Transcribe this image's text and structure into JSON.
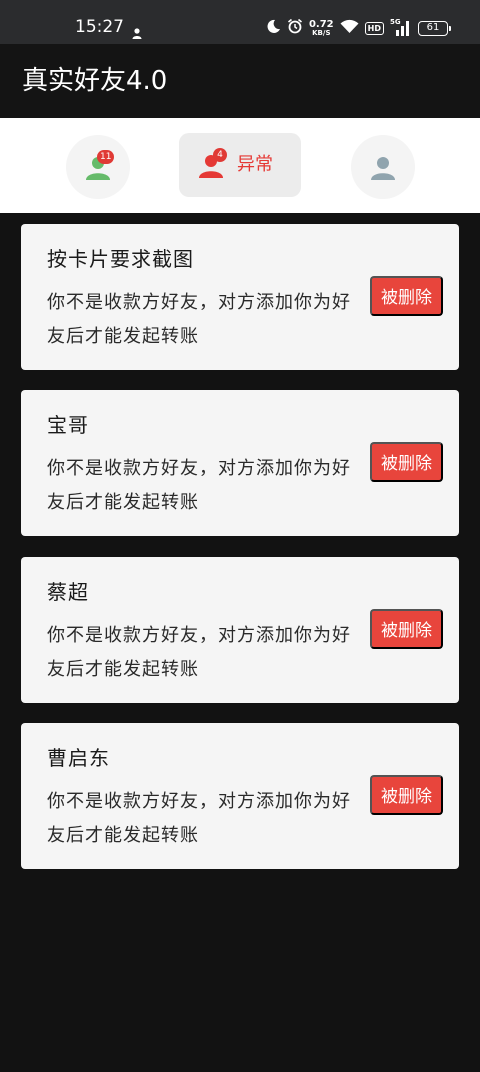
{
  "status_bar": {
    "time": "15:27",
    "net_speed": "0.72",
    "net_unit": "KB/S",
    "hd": "HD",
    "signal": "5G",
    "battery": "61",
    "icons": [
      "person-icon",
      "moon-icon",
      "alarm-icon",
      "wifi-icon",
      "hd-icon",
      "signal-icon",
      "battery-icon"
    ]
  },
  "app": {
    "title": "真实好友4.0"
  },
  "tabs": [
    {
      "name": "normal",
      "badge": "11",
      "icon": "person-icon",
      "color": "#66bb6a"
    },
    {
      "name": "abnormal",
      "badge": "4",
      "label": "异常",
      "icon": "person-icon",
      "color": "#e53935"
    },
    {
      "name": "deleted",
      "icon": "person-icon",
      "color": "#90a4ae"
    }
  ],
  "contacts": [
    {
      "name": "按卡片要求截图",
      "desc": "你不是收款方好友，对方添加你为好友后才能发起转账",
      "button": "被删除"
    },
    {
      "name": "宝哥",
      "desc": "你不是收款方好友，对方添加你为好友后才能发起转账",
      "button": "被删除"
    },
    {
      "name": "蔡超",
      "desc": "你不是收款方好友，对方添加你为好友后才能发起转账",
      "button": "被删除"
    },
    {
      "name": "曹启东",
      "desc": "你不是收款方好友，对方添加你为好友后才能发起转账",
      "button": "被删除"
    }
  ],
  "colors": {
    "background": "#121212",
    "accent_red": "#e8453c",
    "card": "#f5f5f5"
  }
}
